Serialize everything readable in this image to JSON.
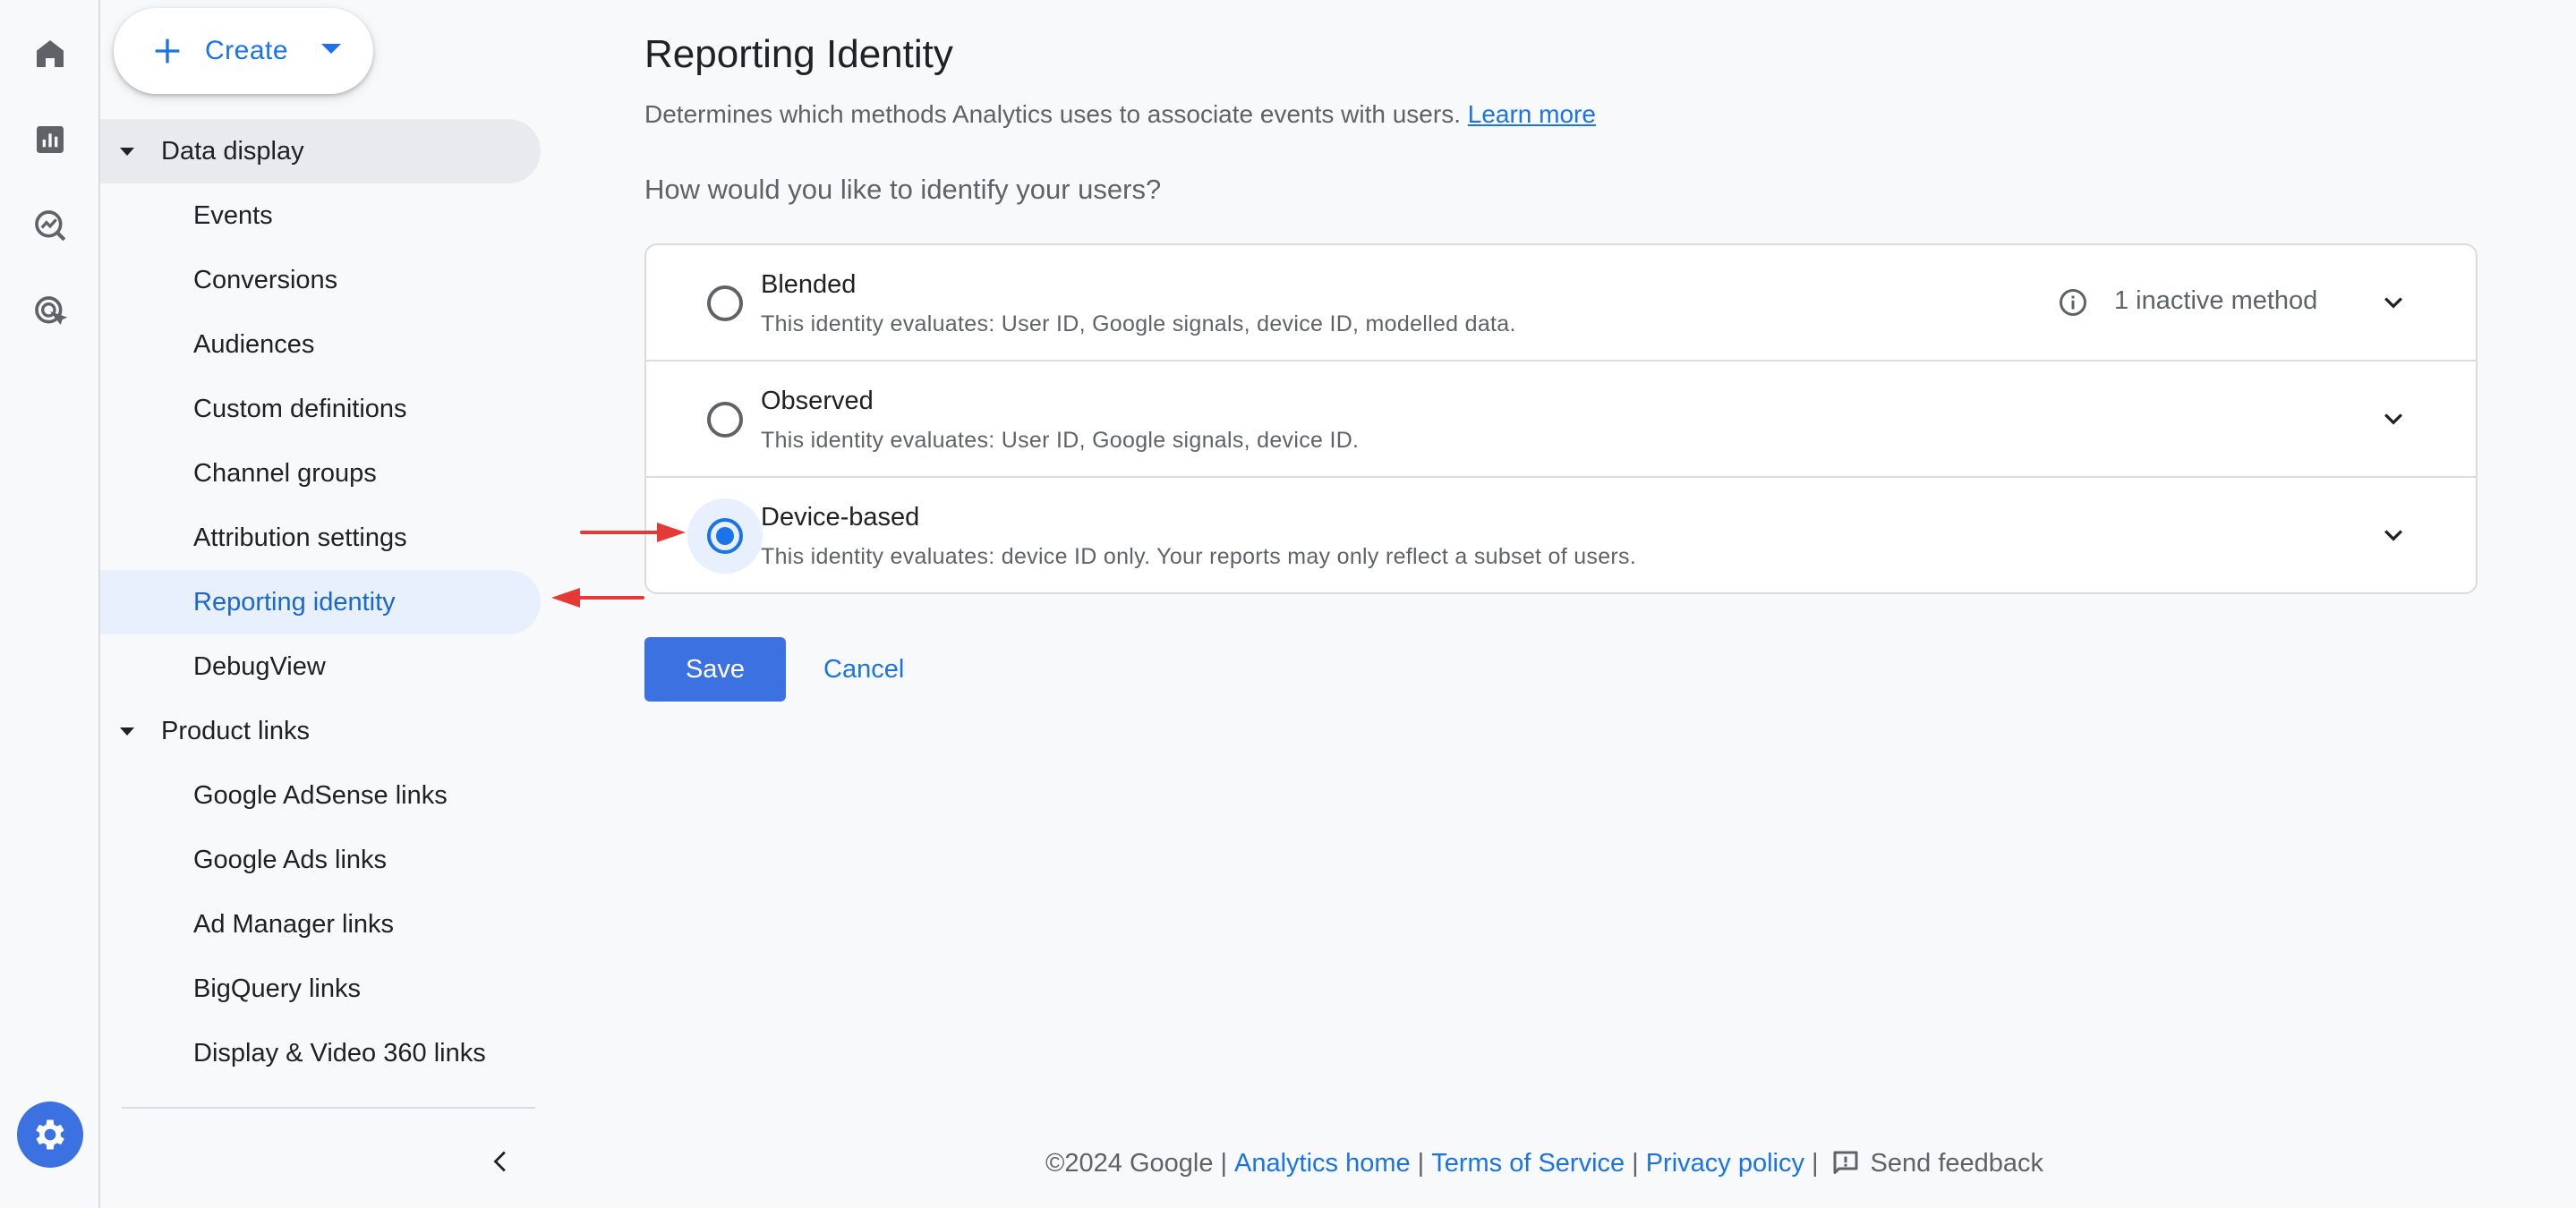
{
  "rail": {
    "icons": [
      "home-icon",
      "reports-icon",
      "explore-icon",
      "advertising-icon"
    ],
    "settings_icon": "gear-icon"
  },
  "create": {
    "label": "Create"
  },
  "nav": {
    "groups": [
      {
        "label": "Data display",
        "expanded": true
      },
      {
        "label": "Product links",
        "expanded": true
      }
    ],
    "data_display_items": [
      "Events",
      "Conversions",
      "Audiences",
      "Custom definitions",
      "Channel groups",
      "Attribution settings",
      "Reporting identity",
      "DebugView"
    ],
    "product_links_items": [
      "Google AdSense links",
      "Google Ads links",
      "Ad Manager links",
      "BigQuery links",
      "Display & Video 360 links"
    ],
    "selected": "Reporting identity"
  },
  "page": {
    "title": "Reporting Identity",
    "description": "Determines which methods Analytics uses to associate events with users.",
    "learn_more": "Learn more",
    "question": "How would you like to identify your users?"
  },
  "options": [
    {
      "title": "Blended",
      "subtitle": "This identity evaluates: User ID, Google signals, device ID, modelled data.",
      "note": "1 inactive method",
      "checked": false
    },
    {
      "title": "Observed",
      "subtitle": "This identity evaluates: User ID, Google signals, device ID.",
      "note": "",
      "checked": false
    },
    {
      "title": "Device-based",
      "subtitle": "This identity evaluates: device ID only. Your reports may only reflect a subset of users.",
      "note": "",
      "checked": true
    }
  ],
  "actions": {
    "save": "Save",
    "cancel": "Cancel"
  },
  "footer": {
    "copyright": "©2024 Google",
    "links": [
      "Analytics home",
      "Terms of Service",
      "Privacy policy"
    ],
    "feedback": "Send feedback"
  },
  "colors": {
    "accent": "#1a73e8",
    "annotation_arrow": "#e53935"
  }
}
